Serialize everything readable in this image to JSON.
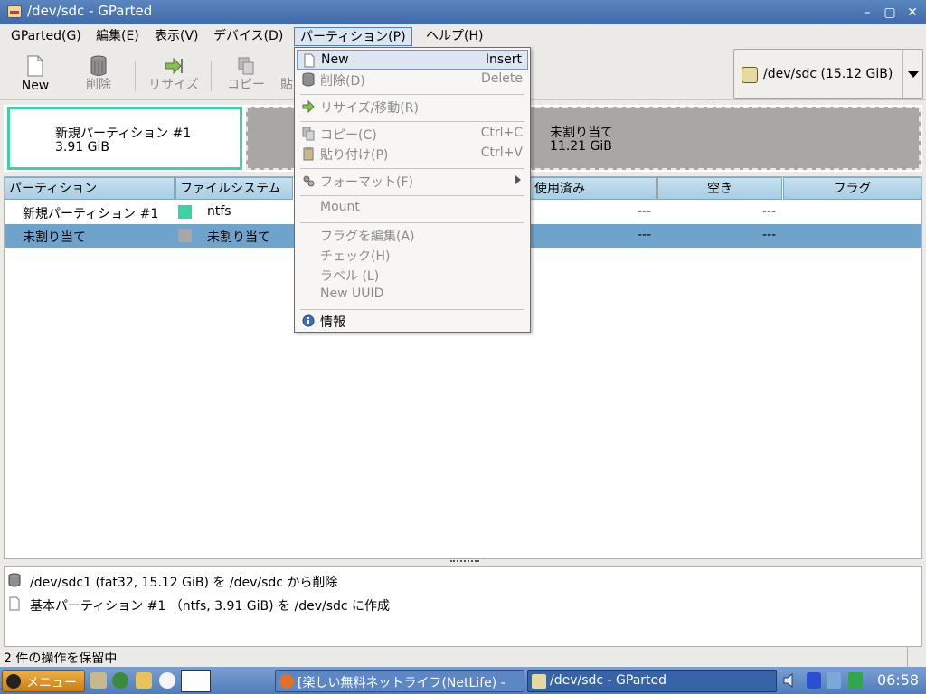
{
  "window": {
    "title": "/dev/sdc - GParted"
  },
  "menubar": {
    "items": [
      "GParted(G)",
      "編集(E)",
      "表示(V)",
      "デバイス(D)",
      "パーティション(P)",
      "ヘルプ(H)"
    ]
  },
  "toolbar": {
    "new_label": "New",
    "delete_label": "削除",
    "resize_label": "リサイズ",
    "copy_label": "コピー",
    "paste_label": "貼"
  },
  "device_selector": {
    "value": "/dev/sdc  (15.12 GiB)"
  },
  "graphic": {
    "ntfs": {
      "name": "新規パーティション #1",
      "size": "3.91 GiB"
    },
    "unallocated": {
      "name": "未割り当て",
      "size": "11.21 GiB"
    }
  },
  "table": {
    "headers": [
      "パーティション",
      "ファイルシステム",
      "使用済み",
      "空き",
      "フラグ"
    ],
    "rows": [
      {
        "partition": "新規パーティション #1",
        "filesystem": "ntfs",
        "used": "---",
        "free": "---",
        "color": "#3dd3a0"
      },
      {
        "partition": "未割り当て",
        "filesystem": "未割り当て",
        "used": "---",
        "free": "---",
        "color": "#a9a7a5"
      }
    ]
  },
  "dropdown": {
    "new": {
      "label": "New",
      "accel": "Insert"
    },
    "delete": {
      "label": "削除(D)",
      "accel": "Delete"
    },
    "resize": {
      "label": "リサイズ/移動(R)"
    },
    "copy": {
      "label": "コピー(C)",
      "accel": "Ctrl+C"
    },
    "paste": {
      "label": "貼り付け(P)",
      "accel": "Ctrl+V"
    },
    "format": {
      "label": "フォーマット(F)"
    },
    "mount": {
      "label": "Mount"
    },
    "flags": {
      "label": "フラグを編集(A)"
    },
    "check": {
      "label": "チェック(H)"
    },
    "label": {
      "label": "ラベル (L)"
    },
    "uuid": {
      "label": "New UUID"
    },
    "info": {
      "label": "情報"
    }
  },
  "operations": [
    "/dev/sdc1 (fat32, 15.12 GiB) を /dev/sdc から削除",
    "基本パーティション #1 （ntfs, 3.91 GiB) を /dev/sdc に作成"
  ],
  "status": {
    "text": "2 件の操作を保留中"
  },
  "taskbar": {
    "start_label": "メニュー",
    "tasks": [
      "[楽しい無料ネットライフ(NetLife) -",
      "/dev/sdc - GParted"
    ],
    "clock": "06:58"
  },
  "colors": {
    "ntfs": "#3dd3a0",
    "unallocated": "#a9a7a5",
    "selection": "#6fa3cc",
    "titlebar": "#4a77b3"
  }
}
